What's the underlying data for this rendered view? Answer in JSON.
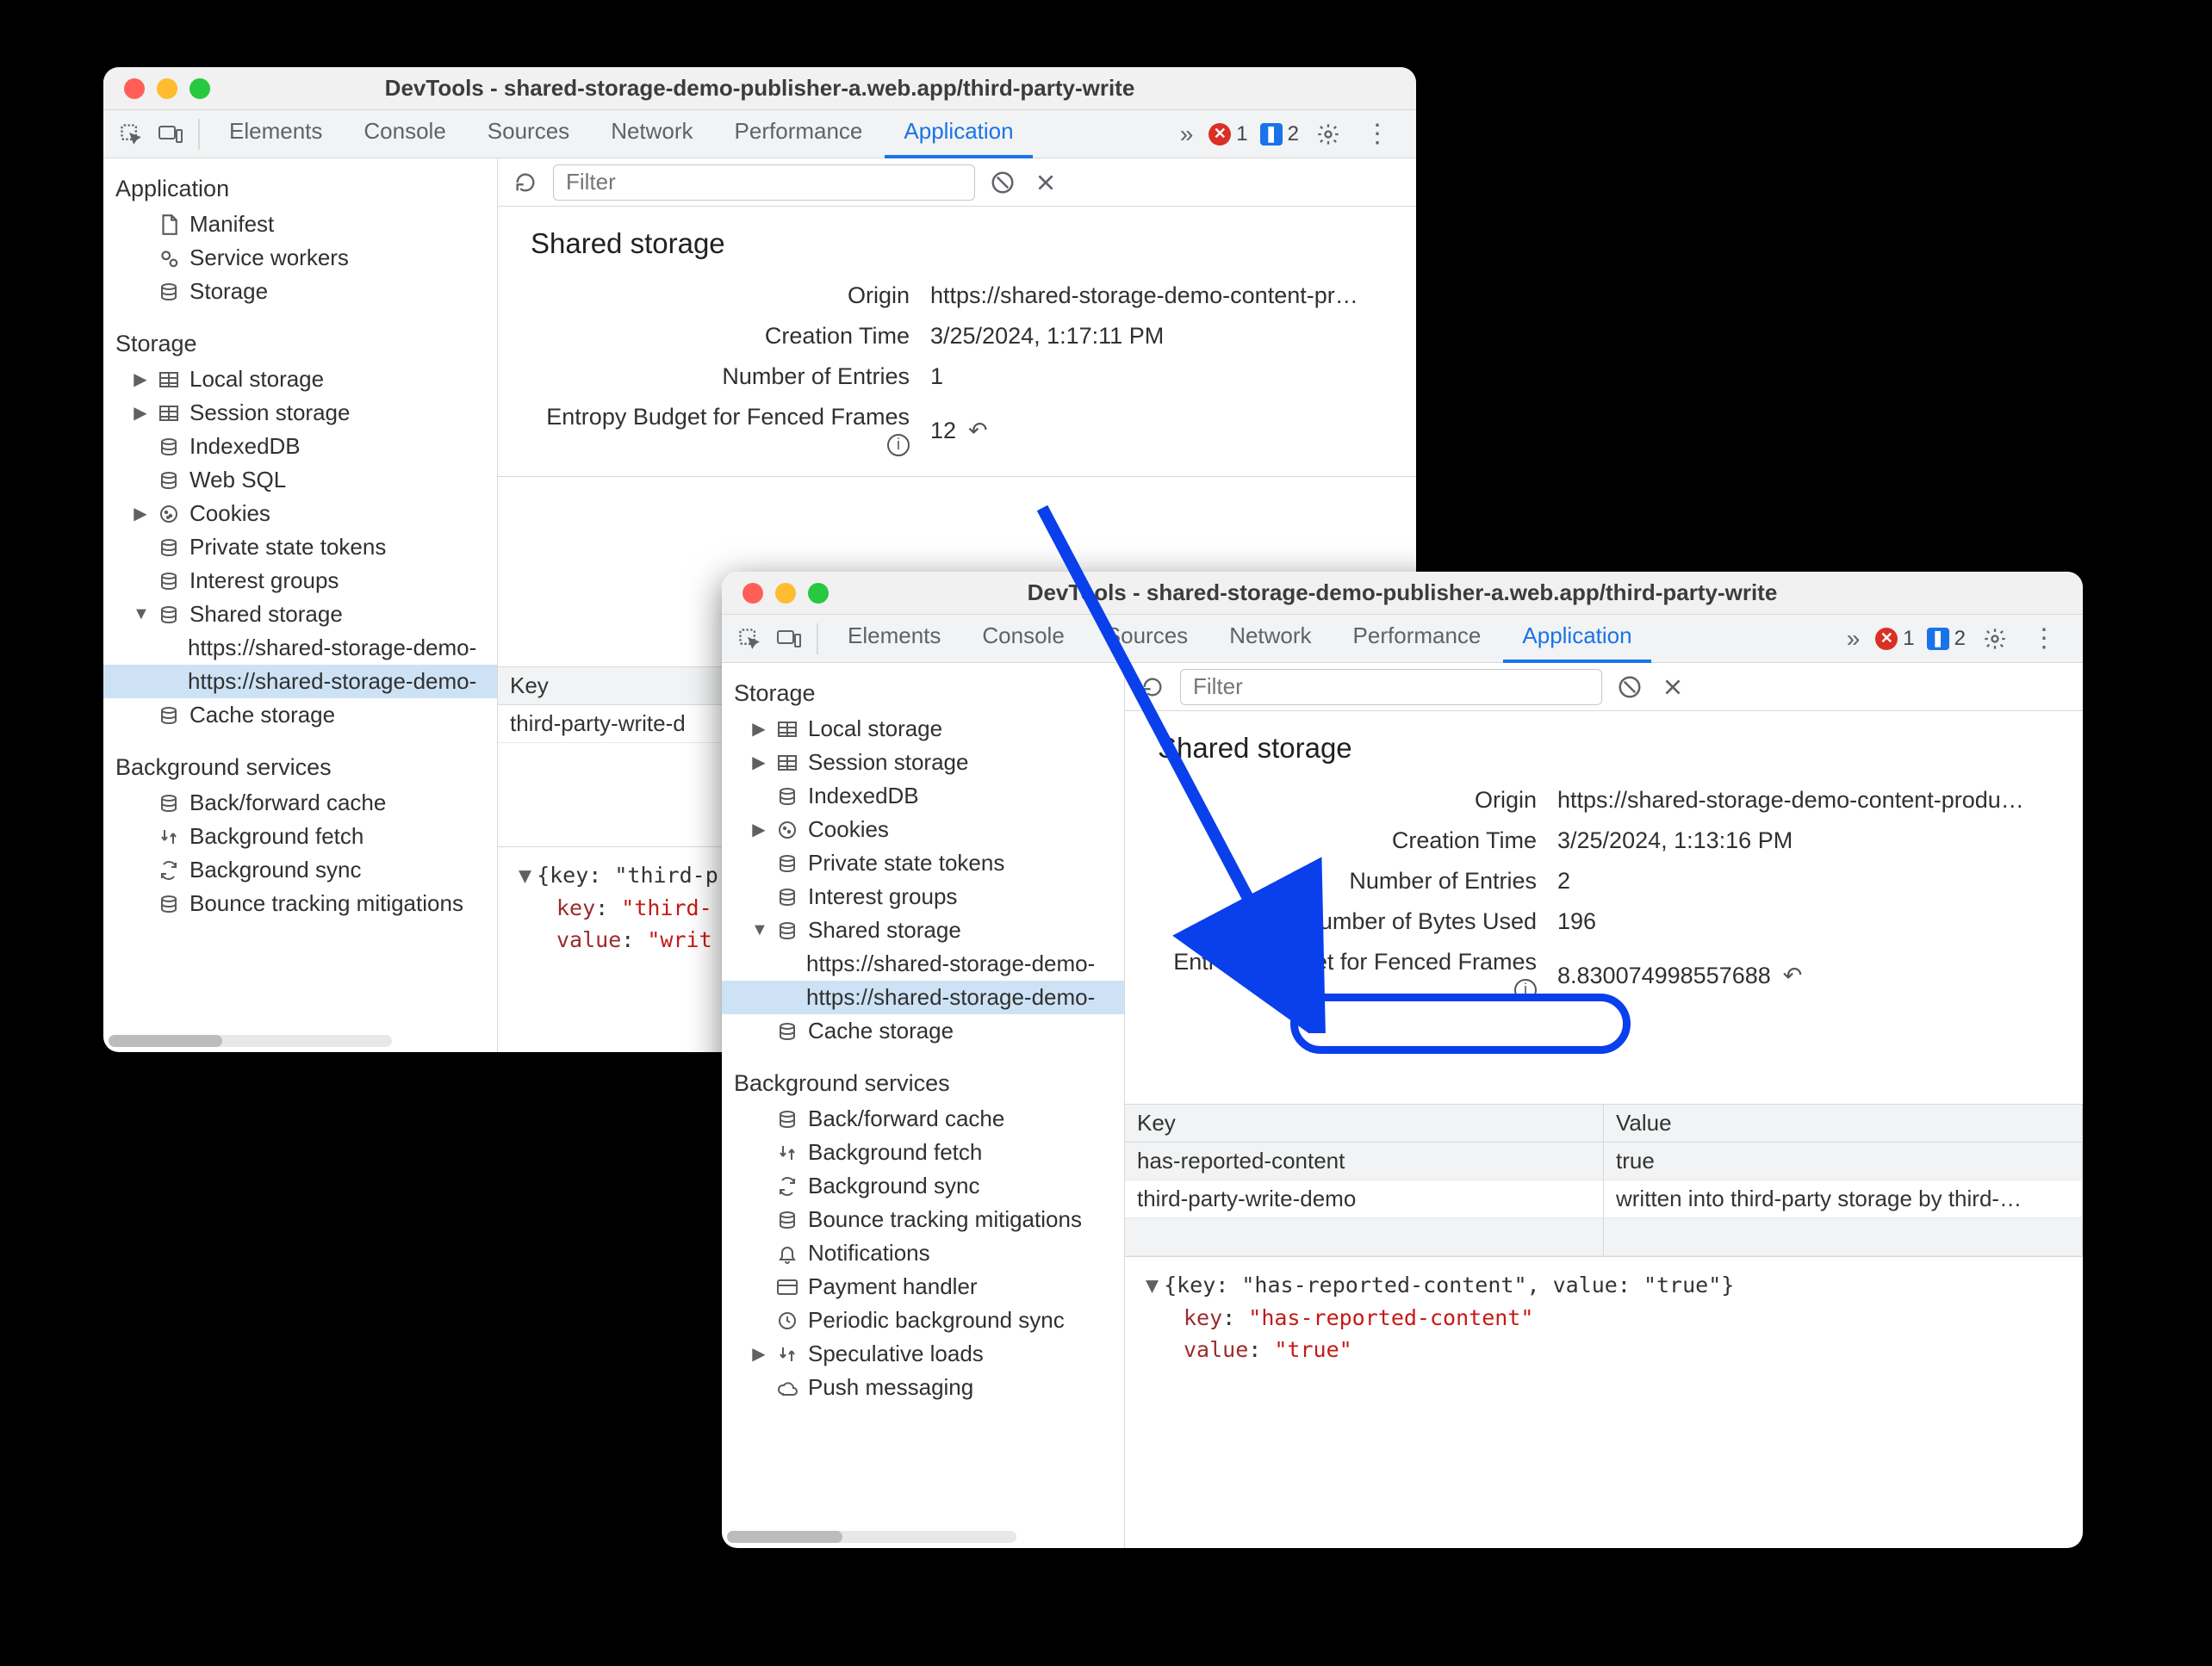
{
  "window1": {
    "title": "DevTools - shared-storage-demo-publisher-a.web.app/third-party-write",
    "tabs": [
      "Elements",
      "Console",
      "Sources",
      "Network",
      "Performance",
      "Application"
    ],
    "active_tab": "Application",
    "error_count": "1",
    "info_count": "2",
    "filter_placeholder": "Filter",
    "sidebar": {
      "groups": [
        {
          "title": "Application",
          "items": [
            {
              "icon": "file",
              "label": "Manifest"
            },
            {
              "icon": "gears",
              "label": "Service workers"
            },
            {
              "icon": "db",
              "label": "Storage"
            }
          ]
        },
        {
          "title": "Storage",
          "items": [
            {
              "tri": "right",
              "icon": "grid",
              "label": "Local storage"
            },
            {
              "tri": "right",
              "icon": "grid",
              "label": "Session storage"
            },
            {
              "tri": "none",
              "icon": "db",
              "label": "IndexedDB"
            },
            {
              "tri": "none",
              "icon": "db",
              "label": "Web SQL"
            },
            {
              "tri": "right",
              "icon": "cookie",
              "label": "Cookies"
            },
            {
              "tri": "none",
              "icon": "db",
              "label": "Private state tokens"
            },
            {
              "tri": "none",
              "icon": "db",
              "label": "Interest groups"
            },
            {
              "tri": "down",
              "icon": "db",
              "label": "Shared storage",
              "children": [
                {
                  "label": "https://shared-storage-demo-"
                },
                {
                  "label": "https://shared-storage-demo-",
                  "selected": true
                }
              ]
            },
            {
              "tri": "none",
              "icon": "db",
              "label": "Cache storage"
            }
          ]
        },
        {
          "title": "Background services",
          "items": [
            {
              "tri": "none",
              "icon": "db",
              "label": "Back/forward cache"
            },
            {
              "tri": "none",
              "icon": "fetch",
              "label": "Background fetch"
            },
            {
              "tri": "none",
              "icon": "sync",
              "label": "Background sync"
            },
            {
              "tri": "none",
              "icon": "db",
              "label": "Bounce tracking mitigations"
            }
          ]
        }
      ]
    },
    "panel": {
      "title": "Shared storage",
      "rows": [
        {
          "k": "Origin",
          "v": "https://shared-storage-demo-content-pr…"
        },
        {
          "k": "Creation Time",
          "v": "3/25/2024, 1:17:11 PM"
        },
        {
          "k": "Number of Entries",
          "v": "1"
        },
        {
          "k": "Entropy Budget for Fenced Frames",
          "v": "12",
          "info": true,
          "undo": true
        }
      ],
      "table": {
        "head": [
          "Key"
        ],
        "rows": [
          [
            "third-party-write-d"
          ]
        ]
      },
      "obj": {
        "summary": "{key: \"third-p",
        "lines": [
          {
            "k": "key",
            "v": "\"third-"
          },
          {
            "k": "value",
            "v": "\"writ"
          }
        ]
      }
    }
  },
  "window2": {
    "title": "DevTools - shared-storage-demo-publisher-a.web.app/third-party-write",
    "tabs": [
      "Elements",
      "Console",
      "Sources",
      "Network",
      "Performance",
      "Application"
    ],
    "active_tab": "Application",
    "error_count": "1",
    "info_count": "2",
    "filter_placeholder": "Filter",
    "sidebar": {
      "groups": [
        {
          "title": "Storage",
          "items": [
            {
              "tri": "right",
              "icon": "grid",
              "label": "Local storage"
            },
            {
              "tri": "right",
              "icon": "grid",
              "label": "Session storage"
            },
            {
              "tri": "none",
              "icon": "db",
              "label": "IndexedDB"
            },
            {
              "tri": "right",
              "icon": "cookie",
              "label": "Cookies"
            },
            {
              "tri": "none",
              "icon": "db",
              "label": "Private state tokens"
            },
            {
              "tri": "none",
              "icon": "db",
              "label": "Interest groups"
            },
            {
              "tri": "down",
              "icon": "db",
              "label": "Shared storage",
              "children": [
                {
                  "label": "https://shared-storage-demo-"
                },
                {
                  "label": "https://shared-storage-demo-",
                  "selected": true
                }
              ]
            },
            {
              "tri": "none",
              "icon": "db",
              "label": "Cache storage"
            }
          ]
        },
        {
          "title": "Background services",
          "items": [
            {
              "tri": "none",
              "icon": "db",
              "label": "Back/forward cache"
            },
            {
              "tri": "none",
              "icon": "fetch",
              "label": "Background fetch"
            },
            {
              "tri": "none",
              "icon": "sync",
              "label": "Background sync"
            },
            {
              "tri": "none",
              "icon": "db",
              "label": "Bounce tracking mitigations"
            },
            {
              "tri": "none",
              "icon": "bell",
              "label": "Notifications"
            },
            {
              "tri": "none",
              "icon": "card",
              "label": "Payment handler"
            },
            {
              "tri": "none",
              "icon": "clock",
              "label": "Periodic background sync"
            },
            {
              "tri": "right",
              "icon": "fetch",
              "label": "Speculative loads"
            },
            {
              "tri": "none",
              "icon": "cloud",
              "label": "Push messaging"
            }
          ]
        }
      ]
    },
    "panel": {
      "title": "Shared storage",
      "rows": [
        {
          "k": "Origin",
          "v": "https://shared-storage-demo-content-produ…"
        },
        {
          "k": "Creation Time",
          "v": "3/25/2024, 1:13:16 PM"
        },
        {
          "k": "Number of Entries",
          "v": "2"
        },
        {
          "k": "Number of Bytes Used",
          "v": "196"
        },
        {
          "k": "Entropy Budget for Fenced Frames",
          "v": "8.830074998557688",
          "info": true,
          "undo": true
        }
      ],
      "table": {
        "head": [
          "Key",
          "Value"
        ],
        "rows": [
          [
            "has-reported-content",
            "true"
          ],
          [
            "third-party-write-demo",
            "written into third-party storage by third-…"
          ]
        ]
      },
      "obj": {
        "summary": "{key: \"has-reported-content\", value: \"true\"}",
        "lines": [
          {
            "k": "key",
            "v": "\"has-reported-content\""
          },
          {
            "k": "value",
            "v": "\"true\""
          }
        ]
      }
    }
  }
}
